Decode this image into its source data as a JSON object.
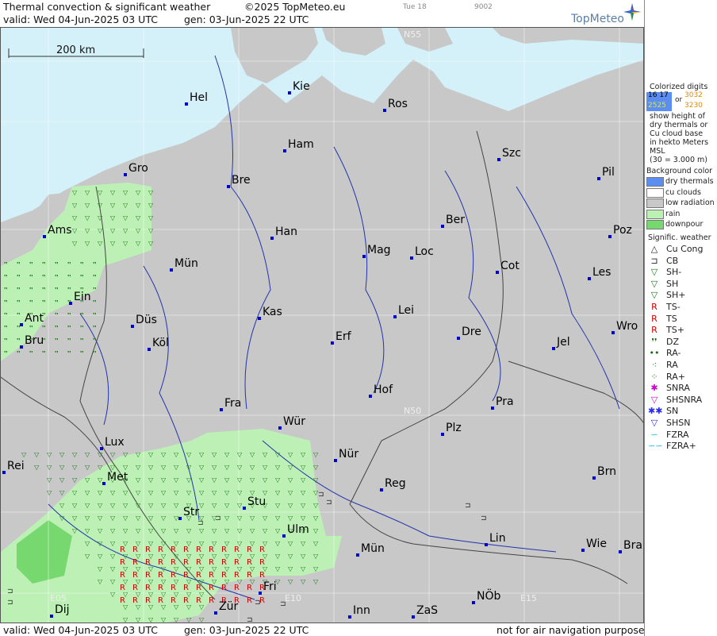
{
  "header": {
    "title": "Thermal convection & significant weather",
    "copyright": "©2025 TopMeteo.eu",
    "day": "Tue 18",
    "code": "9002",
    "valid": "valid:  Wed  04-Jun-2025  03 UTC",
    "gen": "gen: 03-Jun-2025 22 UTC"
  },
  "logo": {
    "text": "TopMeteo"
  },
  "footer": {
    "valid": "valid:  Wed  04-Jun-2025  03 UTC",
    "gen": "gen: 03-Jun-2025 22 UTC",
    "note": "not for air navigation purposes"
  },
  "scale": {
    "label": "200 km"
  },
  "grid_labels": {
    "n55": "N55",
    "n50": "N50",
    "e05": "E05",
    "e10": "E10",
    "e15": "E15"
  },
  "cities": [
    {
      "name": "Hel"
    },
    {
      "name": "Kie"
    },
    {
      "name": "Ros"
    },
    {
      "name": "Ham"
    },
    {
      "name": "Szc"
    },
    {
      "name": "Gro"
    },
    {
      "name": "Bre"
    },
    {
      "name": "Pil"
    },
    {
      "name": "Ber"
    },
    {
      "name": "Ams"
    },
    {
      "name": "Han"
    },
    {
      "name": "Poz"
    },
    {
      "name": "Mün"
    },
    {
      "name": "Mag"
    },
    {
      "name": "Loc"
    },
    {
      "name": "Cot"
    },
    {
      "name": "Les"
    },
    {
      "name": "Ein"
    },
    {
      "name": "Kas"
    },
    {
      "name": "Lei"
    },
    {
      "name": "Ant"
    },
    {
      "name": "Düs"
    },
    {
      "name": "Wro"
    },
    {
      "name": "Bru"
    },
    {
      "name": "Köl"
    },
    {
      "name": "Erf"
    },
    {
      "name": "Dre"
    },
    {
      "name": "Jel"
    },
    {
      "name": "Hof"
    },
    {
      "name": "Fra"
    },
    {
      "name": "Pra"
    },
    {
      "name": "Wür"
    },
    {
      "name": "Plz"
    },
    {
      "name": "Lux"
    },
    {
      "name": "Nür"
    },
    {
      "name": "Rei"
    },
    {
      "name": "Met"
    },
    {
      "name": "Reg"
    },
    {
      "name": "Brn"
    },
    {
      "name": "Stu"
    },
    {
      "name": "Str"
    },
    {
      "name": "Ulm"
    },
    {
      "name": "Lin"
    },
    {
      "name": "Mün"
    },
    {
      "name": "Wie"
    },
    {
      "name": "Bra"
    },
    {
      "name": "Fri"
    },
    {
      "name": "Dij"
    },
    {
      "name": "Zür"
    },
    {
      "name": "Inn"
    },
    {
      "name": "ZaS"
    },
    {
      "name": "NÖb"
    }
  ],
  "legend": {
    "title": "Colorized digits",
    "d1": "16 17",
    "d2": "3032",
    "or": "or",
    "d3": "2525",
    "d4": "3230",
    "desc": [
      "show height of",
      "dry thermals or",
      "Cu cloud base",
      "in hekto Meters",
      "MSL",
      "(30 = 3.000 m)"
    ],
    "bg_title": "Background color",
    "bg_items": [
      {
        "label": "dry thermals",
        "color": "#5b8ef0"
      },
      {
        "label": "cu clouds",
        "color": "#ffffff"
      },
      {
        "label": "low radiation",
        "color": "#c8c8c8"
      },
      {
        "label": "rain",
        "color": "#bdf0b5"
      },
      {
        "label": "downpour",
        "color": "#78d870"
      }
    ],
    "sig_title": "Signific. weather",
    "sig_items": [
      {
        "label": "Cu Cong",
        "sym": "△",
        "color": "#222"
      },
      {
        "label": "CB",
        "sym": "⊐",
        "color": "#222"
      },
      {
        "label": "SH-",
        "sym": "▽",
        "color": "#1a7a1a"
      },
      {
        "label": "SH",
        "sym": "▽",
        "color": "#1a7a1a"
      },
      {
        "label": "SH+",
        "sym": "▽",
        "color": "#1a7a1a"
      },
      {
        "label": "TS-",
        "sym": "R",
        "color": "#cc0000"
      },
      {
        "label": "TS",
        "sym": "R",
        "color": "#cc0000"
      },
      {
        "label": "TS+",
        "sym": "R",
        "color": "#cc0000"
      },
      {
        "label": "DZ",
        "sym": "❜❜",
        "color": "#1a6a1a"
      },
      {
        "label": "RA-",
        "sym": "••",
        "color": "#1a6a1a"
      },
      {
        "label": "RA",
        "sym": "⁖",
        "color": "#1a6a1a"
      },
      {
        "label": "RA+",
        "sym": "⁘",
        "color": "#1a6a1a"
      },
      {
        "label": "SNRA",
        "sym": "✱",
        "color": "#cc00cc"
      },
      {
        "label": "SHSNRA",
        "sym": "▽",
        "color": "#cc00cc"
      },
      {
        "label": "SN",
        "sym": "✱✱",
        "color": "#2a2aee"
      },
      {
        "label": "SHSN",
        "sym": "▽",
        "color": "#2a2aee"
      },
      {
        "label": "FZRA",
        "sym": "∽",
        "color": "#22bbee"
      },
      {
        "label": "FZRA+",
        "sym": "∽∽",
        "color": "#22bbee"
      }
    ]
  },
  "colors": {
    "sea": "#d4f0f8",
    "land": "#c8c8c8",
    "rain": "#bdf0b5",
    "downpour": "#78d870",
    "river": "#2233aa",
    "border": "#444444",
    "grid": "#ffffff",
    "city": "#0000cc"
  }
}
